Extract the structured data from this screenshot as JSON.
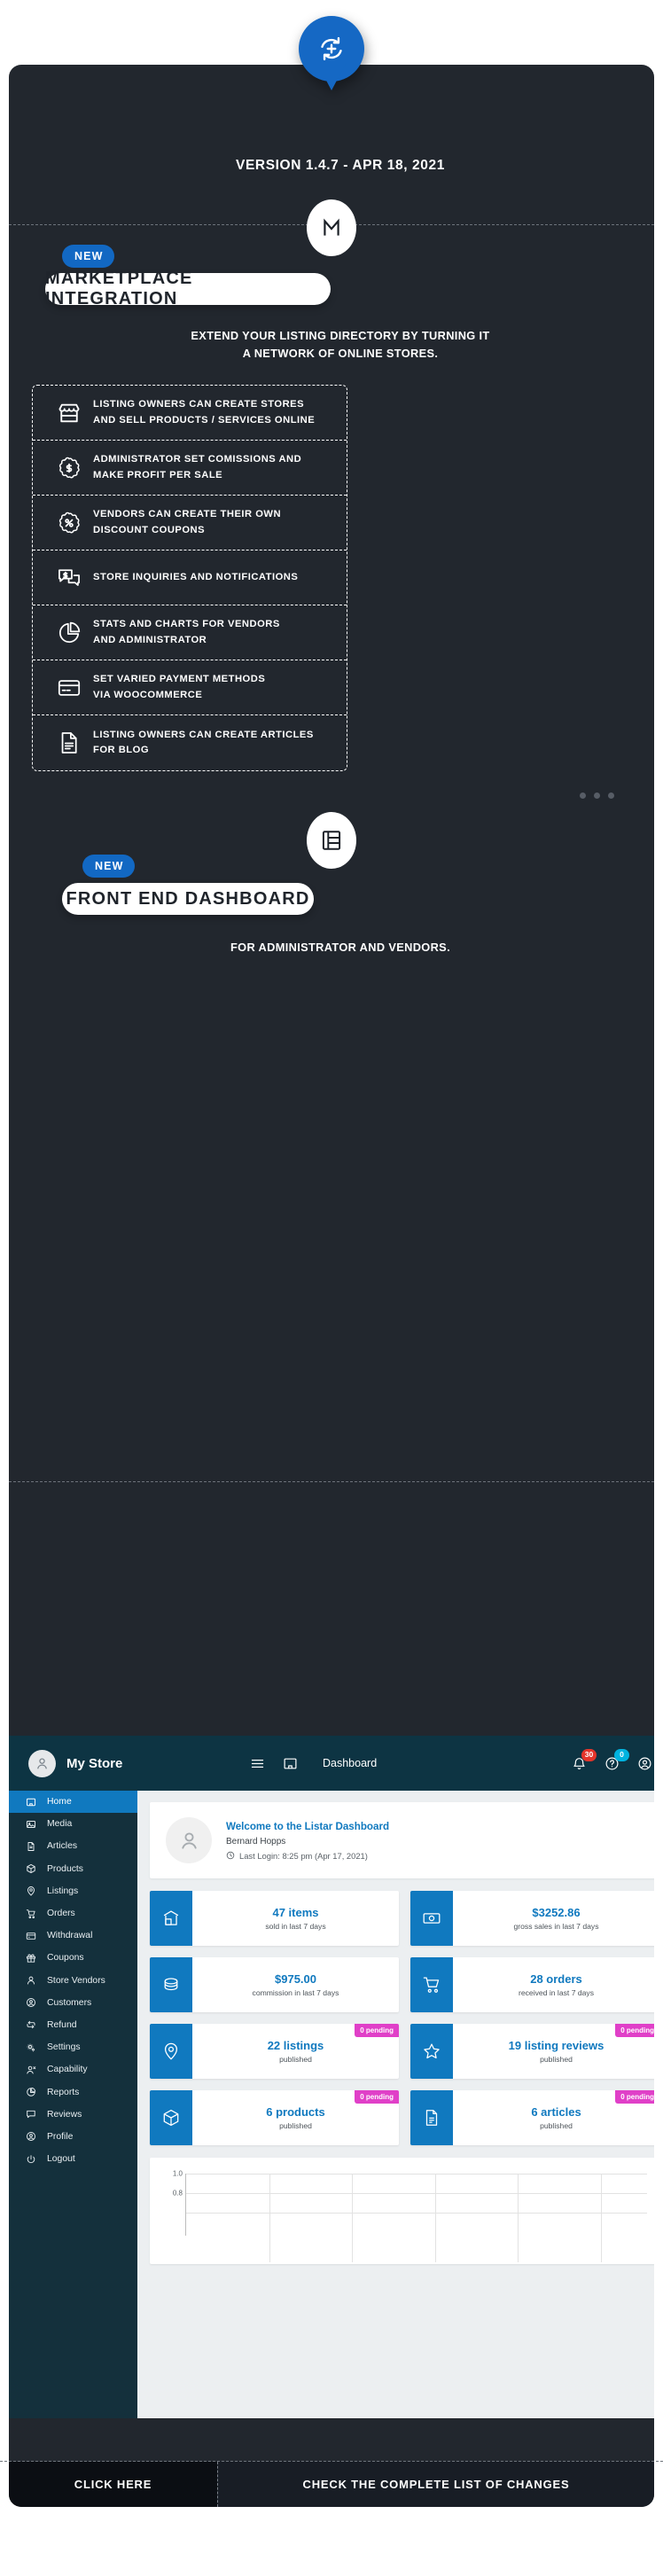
{
  "release": {
    "version_line": "VERSION 1.4.7 - APR 18, 2021",
    "pin_icon": "refresh-plus-icon"
  },
  "colors": {
    "accent_blue": "#1268c3",
    "card_dark": "#22272e",
    "dashboard_header": "#0d3443",
    "dashboard_sidebar": "#14303c",
    "dashboard_active": "#1079bf",
    "pending_pink": "#e040c8",
    "notification_red": "#e5352b",
    "notification_cyan": "#00b3e0"
  },
  "sections": [
    {
      "badge": "NEW",
      "icon": "marketplace-m-icon",
      "title": "MARKETPLACE INTEGRATION",
      "description": "EXTEND YOUR LISTING DIRECTORY BY TURNING IT\nA NETWORK OF ONLINE STORES.",
      "features": [
        {
          "icon": "storefront-icon",
          "line1": "LISTING OWNERS CAN CREATE STORES",
          "line2": "AND SELL PRODUCTS / SERVICES ONLINE"
        },
        {
          "icon": "dollar-badge-icon",
          "line1": "ADMINISTRATOR SET COMISSIONS AND",
          "line2": "MAKE PROFIT PER SALE"
        },
        {
          "icon": "percent-badge-icon",
          "line1": "VENDORS CAN CREATE THEIR OWN",
          "line2": "DISCOUNT COUPONS"
        },
        {
          "icon": "chat-dollar-icon",
          "line1": "STORE INQUIRIES AND NOTIFICATIONS",
          "line2": ""
        },
        {
          "icon": "pie-chart-icon",
          "line1": "STATS AND CHARTS FOR VENDORS",
          "line2": "AND ADMINISTRATOR"
        },
        {
          "icon": "credit-card-icon",
          "line1": "SET VARIED PAYMENT METHODS",
          "line2": "VIA WOOCOMMERCE"
        },
        {
          "icon": "document-icon",
          "line1": "LISTING OWNERS CAN CREATE ARTICLES",
          "line2": "FOR BLOG"
        }
      ]
    },
    {
      "badge": "NEW",
      "icon": "dashboard-layout-icon",
      "title": "FRONT END DASHBOARD",
      "description": "FOR ADMINISTRATOR AND VENDORS."
    }
  ],
  "carousel": {
    "dots": 3
  },
  "dashboard": {
    "header": {
      "store_name": "My Store",
      "avatar_icon": "user-avatar-icon",
      "menu_icon": "hamburger-icon",
      "home_icon": "home-window-icon",
      "breadcrumb": "Dashboard",
      "bell_icon": "bell-icon",
      "bell_count": "30",
      "help_icon": "question-circle-icon",
      "help_count": "0",
      "account_icon": "account-circle-icon"
    },
    "sidebar": [
      {
        "icon": "home-window-icon",
        "label": "Home",
        "active": true
      },
      {
        "icon": "media-image-icon",
        "label": "Media",
        "active": false
      },
      {
        "icon": "document-icon",
        "label": "Articles",
        "active": false
      },
      {
        "icon": "box-icon",
        "label": "Products",
        "active": false
      },
      {
        "icon": "map-pin-icon",
        "label": "Listings",
        "active": false
      },
      {
        "icon": "cart-icon",
        "label": "Orders",
        "active": false
      },
      {
        "icon": "credit-card-icon",
        "label": "Withdrawal",
        "active": false
      },
      {
        "icon": "gift-icon",
        "label": "Coupons",
        "active": false
      },
      {
        "icon": "person-icon",
        "label": "Store Vendors",
        "active": false
      },
      {
        "icon": "account-circle-icon",
        "label": "Customers",
        "active": false
      },
      {
        "icon": "refund-arrows-icon",
        "label": "Refund",
        "active": false
      },
      {
        "icon": "gears-icon",
        "label": "Settings",
        "active": false
      },
      {
        "icon": "person-x-icon",
        "label": "Capability",
        "active": false
      },
      {
        "icon": "pie-chart-icon",
        "label": "Reports",
        "active": false
      },
      {
        "icon": "comment-icon",
        "label": "Reviews",
        "active": false
      },
      {
        "icon": "account-circle-icon",
        "label": "Profile",
        "active": false
      },
      {
        "icon": "power-icon",
        "label": "Logout",
        "active": false
      }
    ],
    "welcome": {
      "avatar_icon": "user-avatar-icon",
      "title": "Welcome to the Listar Dashboard",
      "name": "Bernard Hopps",
      "clock_icon": "clock-icon",
      "last_login": "Last Login: 8:25 pm (Apr 17, 2021)"
    },
    "stats": [
      {
        "icon": "storefront-icon",
        "value": "47 items",
        "sub": "sold in last 7 days",
        "pending": null
      },
      {
        "icon": "banknote-icon",
        "value": "$3252.86",
        "sub": "gross sales in last 7 days",
        "pending": null
      },
      {
        "icon": "coins-icon",
        "value": "$975.00",
        "sub": "commission in last 7 days",
        "pending": null
      },
      {
        "icon": "cart-icon",
        "value": "28 orders",
        "sub": "received in last 7 days",
        "pending": null
      },
      {
        "icon": "map-pin-icon",
        "value": "22 listings",
        "sub": "published",
        "pending": "0 pending"
      },
      {
        "icon": "star-icon",
        "value": "19 listing reviews",
        "sub": "published",
        "pending": "0 pending"
      },
      {
        "icon": "box-icon",
        "value": "6 products",
        "sub": "published",
        "pending": "0 pending"
      },
      {
        "icon": "document-icon",
        "value": "6 articles",
        "sub": "published",
        "pending": "0 pending"
      }
    ],
    "chart_data": {
      "type": "line",
      "title": "",
      "xlabel": "",
      "ylabel": "",
      "yticks": [
        "1.0",
        "0.8"
      ],
      "ylim": [
        0,
        1.0
      ],
      "grid": true,
      "series": [],
      "categories": []
    }
  },
  "footer": {
    "left_label": "CLICK HERE",
    "right_label": "CHECK THE COMPLETE LIST OF CHANGES"
  }
}
